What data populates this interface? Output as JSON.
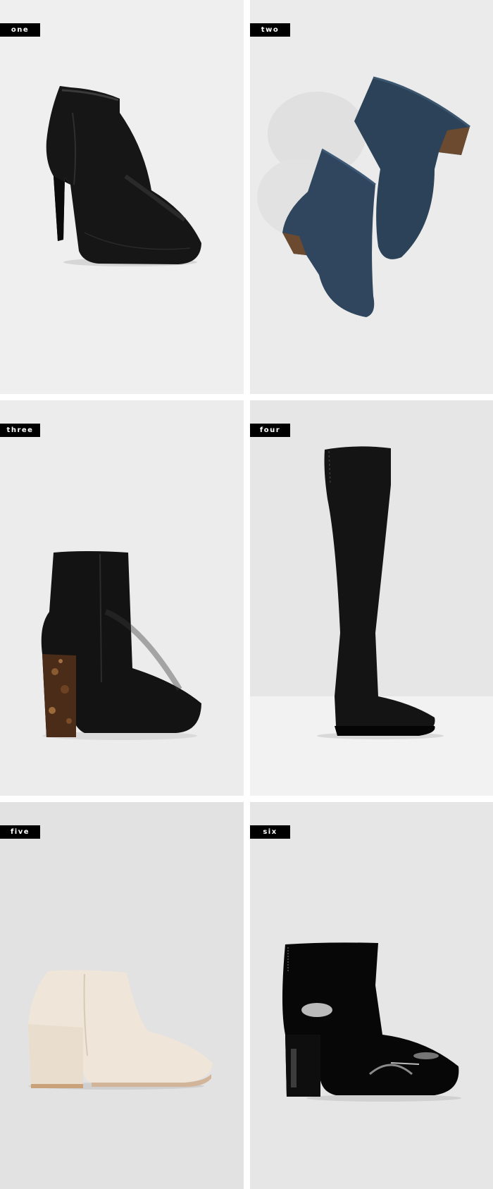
{
  "items": [
    {
      "label": "one",
      "description": "black leather stiletto ankle bootie",
      "background": "#efefef",
      "boot_color": "#161616"
    },
    {
      "label": "two",
      "description": "navy suede block-heel ankle boots",
      "background": "#ebebeb",
      "boot_color": "#2c4258"
    },
    {
      "label": "three",
      "description": "black leather bootie with tortoiseshell block heel",
      "background": "#ececec",
      "boot_color": "#131313"
    },
    {
      "label": "four",
      "description": "black suede over-the-knee flat boot",
      "background": "#e6e6e6",
      "boot_color": "#141414"
    },
    {
      "label": "five",
      "description": "cream suede block-heel ankle bootie",
      "background": "#e2e2e2",
      "boot_color": "#efe5d8"
    },
    {
      "label": "six",
      "description": "black patent block-heel ankle boot with hardware",
      "background": "#e6e6e6",
      "boot_color": "#070707"
    }
  ]
}
